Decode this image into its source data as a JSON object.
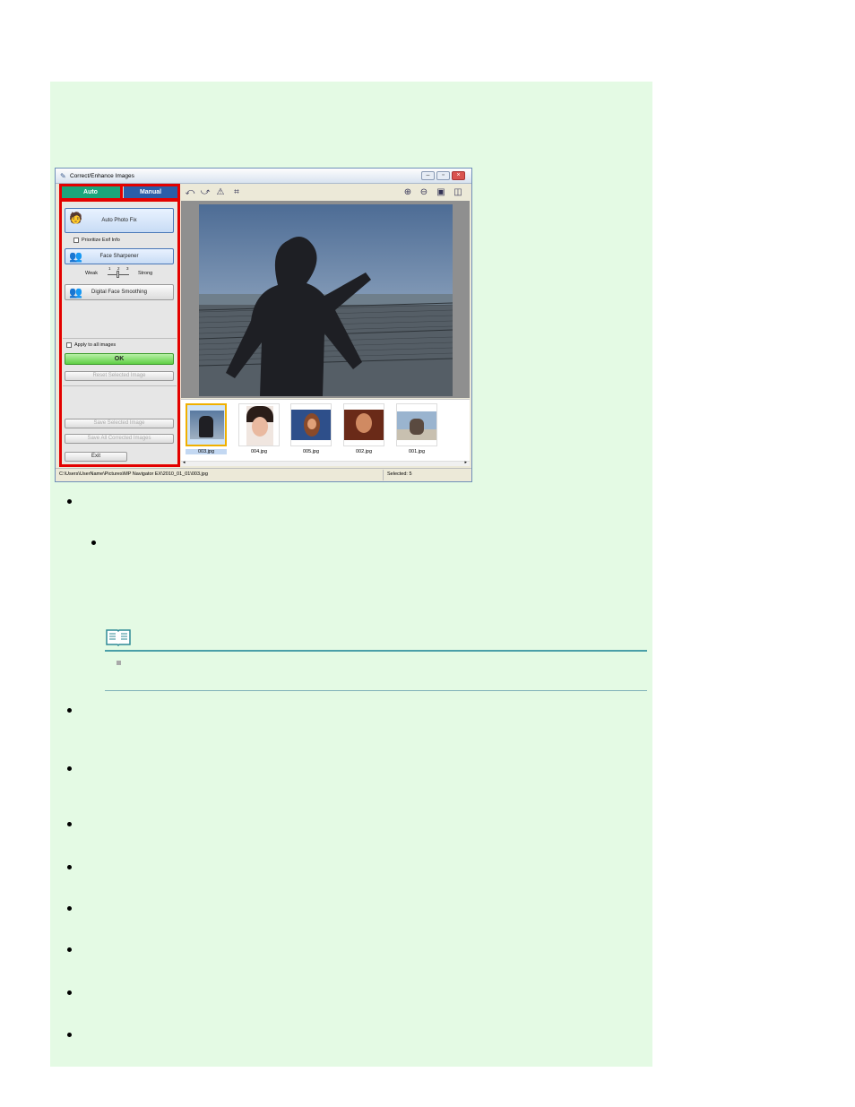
{
  "window": {
    "title": "Correct/Enhance Images",
    "controls": [
      "minimize-icon",
      "restore-icon",
      "close-icon"
    ]
  },
  "tabs": [
    {
      "label": "Auto",
      "active": true
    },
    {
      "label": "Manual",
      "active": false
    }
  ],
  "auto_panel": {
    "auto_photo_fix": "Auto Photo Fix",
    "prioritize_exif": "Prioritize Exif Info",
    "face_sharpener": "Face Sharpener",
    "slider": {
      "weak": "Weak",
      "strong": "Strong",
      "ticks": [
        "1",
        "2",
        "3"
      ],
      "value": 2
    },
    "digital_face_smoothing": "Digital Face Smoothing",
    "apply_all": "Apply to all images",
    "ok": "OK",
    "reset_selected": "Reset Selected Image",
    "save_selected": "Save Selected Image",
    "save_all": "Save All Corrected Images",
    "exit": "Exit"
  },
  "toolbar": {
    "left_icons": [
      "rotate-left-icon",
      "rotate-right-icon",
      "flip-icon",
      "crop-icon"
    ],
    "right_icons": [
      "zoom-in-icon",
      "zoom-out-icon",
      "full-image-icon",
      "compare-icon"
    ]
  },
  "thumbnails": [
    {
      "name": "003.jpg",
      "selected": true
    },
    {
      "name": "004.jpg",
      "selected": false
    },
    {
      "name": "005.jpg",
      "selected": false
    },
    {
      "name": "002.jpg",
      "selected": false
    },
    {
      "name": "001.jpg",
      "selected": false
    }
  ],
  "status": {
    "path": "C:\\Users\\UserName\\Pictures\\MP Navigator EX\\2010_01_01\\003.jpg",
    "selected": "Selected: 5"
  },
  "colors": {
    "panel_bg": "#e4fae4",
    "highlight_frame": "#e30000",
    "auto_tab": "#1aa67b",
    "manual_tab": "#2b5ea8",
    "note_rule": "#4a9fa8"
  }
}
